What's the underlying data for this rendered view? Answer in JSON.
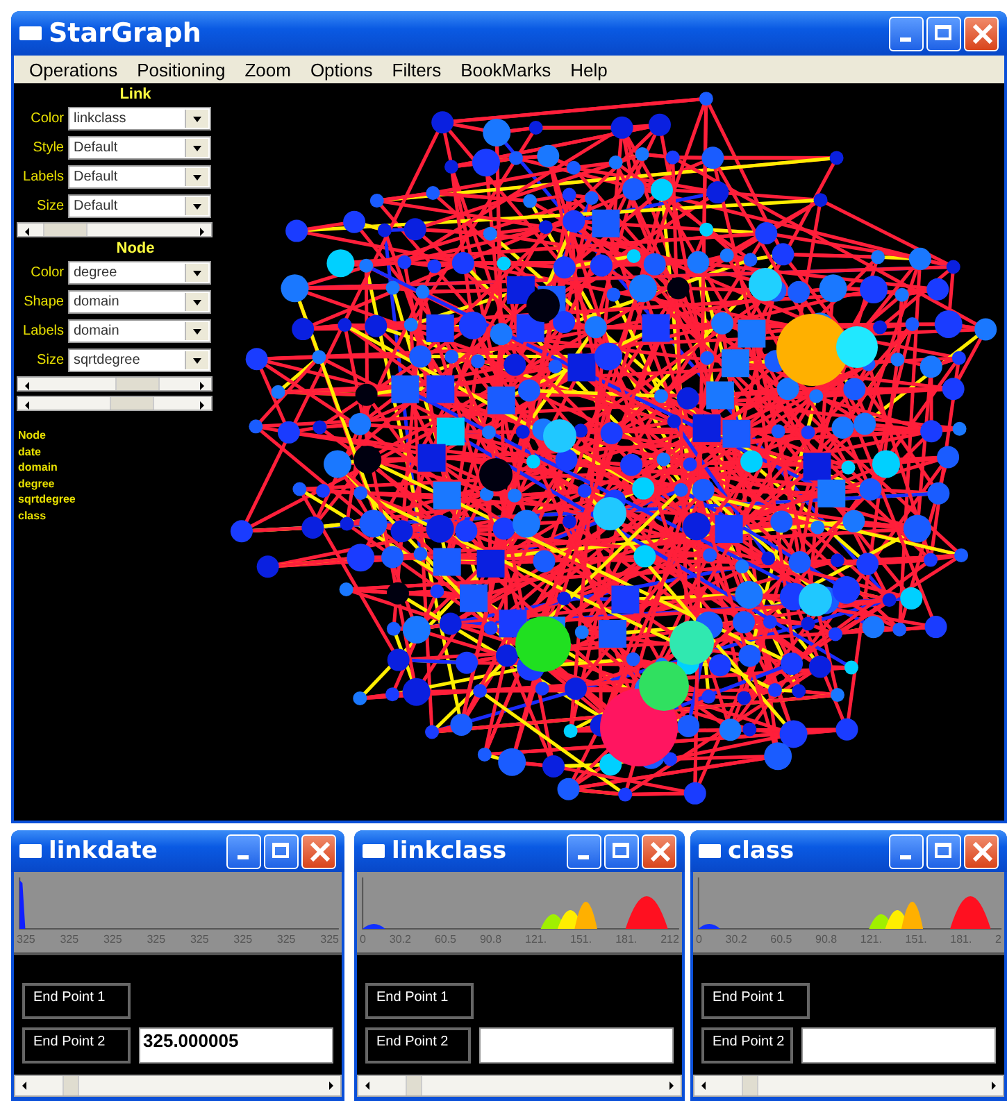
{
  "window": {
    "title": "StarGraph"
  },
  "menu": [
    "Operations",
    "Positioning",
    "Zoom",
    "Options",
    "Filters",
    "BookMarks",
    "Help"
  ],
  "link_panel": {
    "heading": "Link",
    "fields": [
      {
        "label": "Color",
        "value": "linkclass"
      },
      {
        "label": "Style",
        "value": "Default"
      },
      {
        "label": "Labels",
        "value": "Default"
      },
      {
        "label": "Size",
        "value": "Default"
      }
    ]
  },
  "node_panel": {
    "heading": "Node",
    "fields": [
      {
        "label": "Color",
        "value": "degree"
      },
      {
        "label": "Shape",
        "value": "domain"
      },
      {
        "label": "Labels",
        "value": "domain"
      },
      {
        "label": "Size",
        "value": "sqrtdegree"
      }
    ]
  },
  "node_attributes": [
    "Node",
    "date",
    "domain",
    "degree",
    "sqrtdegree",
    "class"
  ],
  "filter_windows": [
    {
      "title": "linkdate",
      "kind": "spike",
      "ticks": [
        "325",
        "325",
        "325",
        "325",
        "325",
        "325",
        "325",
        "325"
      ],
      "end_point_1": "End Point 1",
      "end_point_2": "End Point 2",
      "value": "325.000005"
    },
    {
      "title": "linkclass",
      "kind": "peaks",
      "ticks": [
        "0",
        "30.2",
        "60.5",
        "90.8",
        "121.",
        "151.",
        "181.",
        "212"
      ],
      "end_point_1": "End Point 1",
      "end_point_2": "End Point 2"
    },
    {
      "title": "class",
      "kind": "peaks",
      "ticks": [
        "0",
        "30.2",
        "60.5",
        "90.8",
        "121.",
        "151.",
        "181.",
        "2"
      ],
      "end_point_1": "End Point 1",
      "end_point_2": "End Point 2"
    }
  ]
}
